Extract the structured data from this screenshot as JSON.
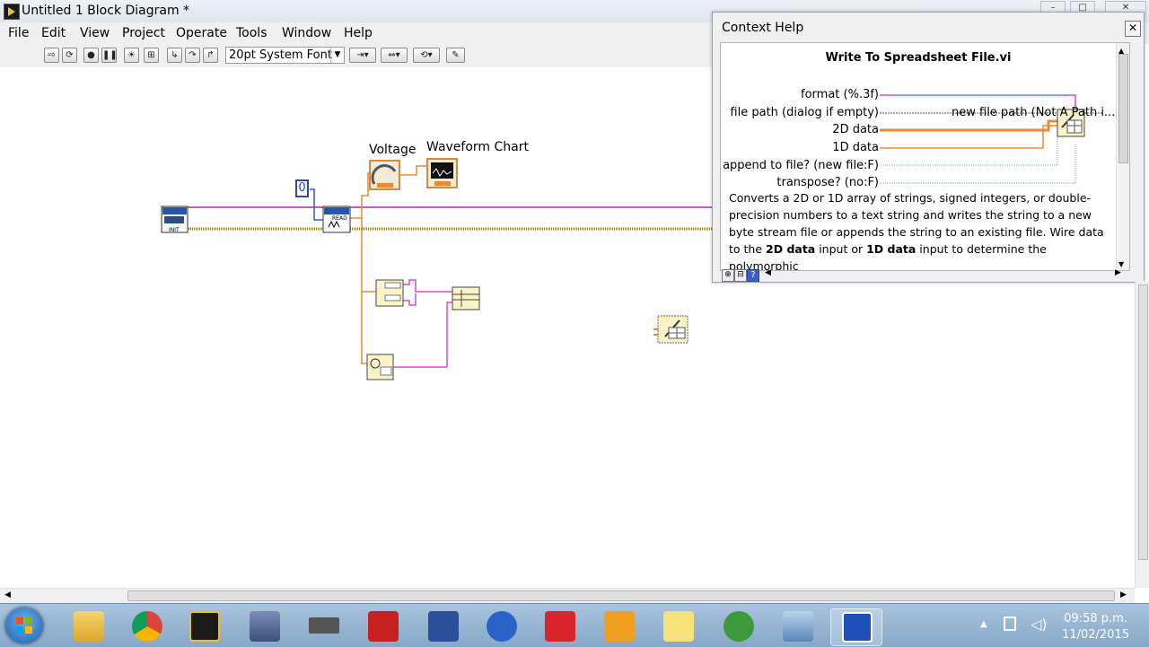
{
  "window": {
    "title": "Untitled 1 Block Diagram *"
  },
  "menu": [
    "File",
    "Edit",
    "View",
    "Project",
    "Operate",
    "Tools",
    "Window",
    "Help"
  ],
  "toolbar": {
    "font": "20pt System Font"
  },
  "diagram": {
    "constant_value": "0",
    "labels": {
      "voltage": "Voltage",
      "chart": "Waveform Chart"
    },
    "init_block": "INIT",
    "read_block": "READ"
  },
  "context_help": {
    "caption": "Context Help",
    "vi_name": "Write To Spreadsheet File.vi",
    "inputs": [
      "format (%.3f)",
      "file path (dialog if empty)",
      "2D data",
      "1D data",
      "append to file? (new file:F)",
      "transpose? (no:F)"
    ],
    "output": "new file path (Not A Path i...",
    "description": {
      "p1": "Converts a 2D or 1D array of strings, signed integers, or double-precision numbers to a text string and writes the string to a new byte stream file or appends the string to an existing file. Wire data to the ",
      "b1": "2D data",
      "p2": " input or ",
      "b2": "1D data",
      "p3": " input to determine the polymorphic"
    }
  },
  "taskbar": {
    "apps": [
      "file-explorer-icon",
      "chrome-icon",
      "labview-launcher-icon",
      "multisim-icon",
      "chip-icon",
      "pickit2-icon",
      "dev-cpp-icon",
      "star-app-icon",
      "solidworks-icon",
      "vi-app-icon",
      "labview-icon",
      "tools-icon",
      "network-icon",
      "active-window-icon"
    ],
    "time": "09:58 p.m.",
    "date": "11/02/2015"
  },
  "colors": {
    "wire_pink": "#d84fd4",
    "wire_orange": "#e88a30",
    "wire_olive": "#8a7a20",
    "wire_blue": "#3355cc"
  }
}
